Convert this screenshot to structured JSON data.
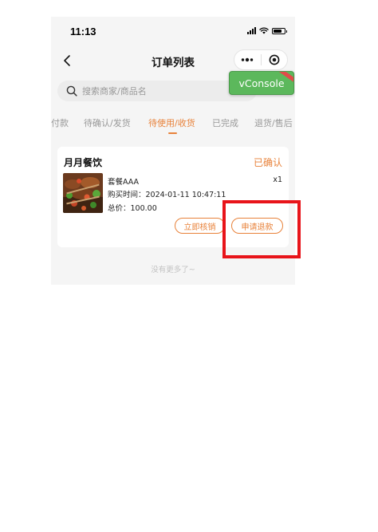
{
  "status_bar": {
    "time": "11:13"
  },
  "nav": {
    "title": "订单列表"
  },
  "search": {
    "placeholder": "搜索商家/商品名"
  },
  "vconsole": {
    "label": "vConsole"
  },
  "tabs": [
    {
      "label": "付款",
      "active": false
    },
    {
      "label": "待确认/发货",
      "active": false
    },
    {
      "label": "待使用/收货",
      "active": true
    },
    {
      "label": "已完成",
      "active": false
    },
    {
      "label": "退货/售后",
      "active": false
    }
  ],
  "order": {
    "shop_name": "月月餐饮",
    "status": "已确认",
    "product_name": "套餐AAA",
    "quantity": "x1",
    "time_text": "购买时间：2024-01-11 10:47:11",
    "total_text": "总价：100.00",
    "verify_button": "立即核销",
    "refund_button": "申请退款"
  },
  "footer": {
    "no_more": "没有更多了~"
  },
  "colors": {
    "accent": "#e8823a",
    "highlight": "#e8141a",
    "vconsole": "#5cb85c",
    "background": "#f5f5f5"
  },
  "icons": [
    "back-icon",
    "more-icon",
    "close-target-icon",
    "search-icon",
    "signal-icon",
    "wifi-icon",
    "battery-icon"
  ]
}
